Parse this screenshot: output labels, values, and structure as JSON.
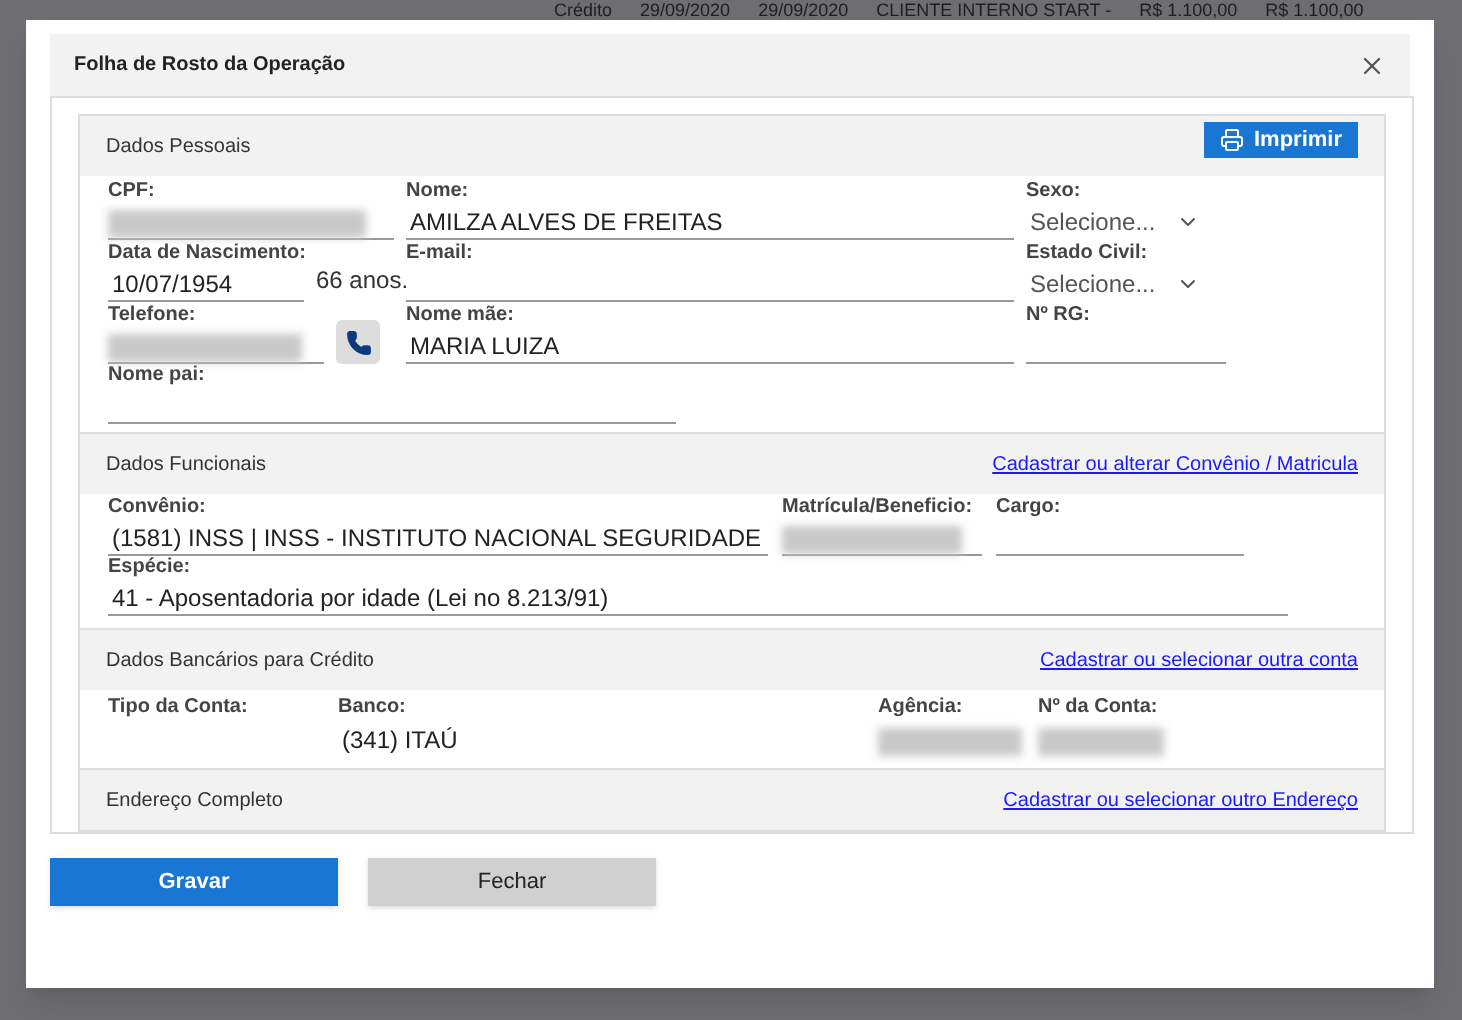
{
  "background_row": [
    "Crédito",
    "29/09/2020",
    "29/09/2020",
    "CLIENTE INTERNO START -",
    "R$ 1.100,00",
    "R$ 1.100,00"
  ],
  "dialog": {
    "title": "Folha de Rosto da Operação"
  },
  "personal": {
    "title": "Dados Pessoais",
    "print_button": "Imprimir",
    "cpf": {
      "label": "CPF:",
      "kind": "redacted"
    },
    "birth": {
      "label": "Data de Nascimento:",
      "kind": "text",
      "value": "10/07/1954"
    },
    "age": "66 anos.",
    "phone": {
      "label": "Telefone:",
      "kind": "redacted"
    },
    "name": {
      "label": "Nome:",
      "kind": "text",
      "value": "AMILZA ALVES DE FREITAS"
    },
    "email": {
      "label": "E-mail:"
    },
    "mother": {
      "label": "Nome mãe:",
      "kind": "text",
      "value": "MARIA LUIZA"
    },
    "sex": {
      "label": "Sexo:",
      "kind": "select",
      "value": "Selecione..."
    },
    "marital": {
      "label": "Estado Civil:",
      "kind": "select",
      "value": "Selecione..."
    },
    "rg": {
      "label": "Nº RG:"
    },
    "father": {
      "label": "Nome pai:"
    }
  },
  "functional": {
    "title": "Dados Funcionais",
    "link": "Cadastrar ou alterar Convênio / Matricula",
    "agreement": {
      "label": "Convênio:",
      "kind": "text",
      "value": "(1581) INSS | INSS - INSTITUTO NACIONAL SEGURIDADE"
    },
    "registration": {
      "label": "Matrícula/Beneficio:",
      "kind": "redacted"
    },
    "position": {
      "label": "Cargo:"
    },
    "species": {
      "label": "Espécie:",
      "kind": "text",
      "value": "41 - Aposentadoria por idade (Lei no 8.213/91)"
    }
  },
  "bank": {
    "title": "Dados Bancários para Crédito",
    "link": "Cadastrar ou selecionar outra conta",
    "account_type": {
      "label": "Tipo da Conta:"
    },
    "bank": {
      "label": "Banco:",
      "kind": "text",
      "value": "(341) ITAÚ"
    },
    "branch": {
      "label": "Agência:",
      "kind": "redacted"
    },
    "account": {
      "label": "Nº da Conta:",
      "kind": "redacted"
    }
  },
  "address": {
    "title": "Endereço Completo",
    "link": "Cadastrar ou selecionar outro Endereço"
  },
  "buttons": [
    {
      "label": "Gravar",
      "kind": "primary"
    },
    {
      "label": "Fechar",
      "kind": "secondary"
    }
  ]
}
